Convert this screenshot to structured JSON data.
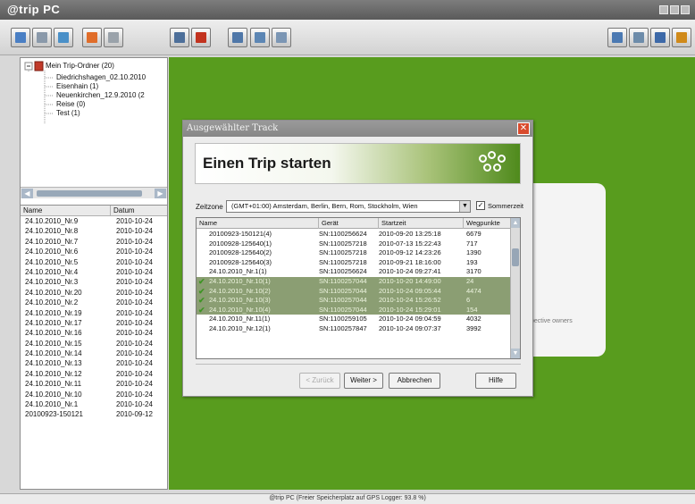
{
  "app": {
    "title": "@trip PC"
  },
  "toolbar": {
    "left_buttons": [
      {
        "name": "import-button",
        "color": "#4a7fc4"
      },
      {
        "name": "export-button",
        "color": "#8a99aa"
      },
      {
        "name": "trip-button",
        "color": "#4a90c8"
      },
      {
        "name": "settings-button",
        "color": "#e06d2a"
      },
      {
        "name": "edit-button",
        "color": "#9aa2aa"
      },
      {
        "name": "print-button",
        "color": "#4d6f9a"
      },
      {
        "name": "photo-button",
        "color": "#c2331f"
      },
      {
        "name": "slideshow-button",
        "color": "#4f77a8"
      },
      {
        "name": "map-button",
        "color": "#5c86b4"
      },
      {
        "name": "report-button",
        "color": "#7b96b4"
      }
    ],
    "right_buttons": [
      {
        "name": "device-button",
        "color": "#4b79b2"
      },
      {
        "name": "network-button",
        "color": "#6d8caa"
      },
      {
        "name": "card-button",
        "color": "#3d69a8"
      },
      {
        "name": "help-button",
        "color": "#d08a1a"
      }
    ]
  },
  "tree": {
    "root": "Mein Trip-Ordner (20)",
    "children": [
      "Diedrichshagen_02.10.2010",
      "Eisenhain (1)",
      "Neuenkirchen_12.9.2010 (2",
      "Reise (0)",
      "Test (1)"
    ]
  },
  "list": {
    "header_name": "Name",
    "header_date": "Datum",
    "rows": [
      [
        "24.10.2010_Nr.9",
        "2010-10-24"
      ],
      [
        "24.10.2010_Nr.8",
        "2010-10-24"
      ],
      [
        "24.10.2010_Nr.7",
        "2010-10-24"
      ],
      [
        "24.10.2010_Nr.6",
        "2010-10-24"
      ],
      [
        "24.10.2010_Nr.5",
        "2010-10-24"
      ],
      [
        "24.10.2010_Nr.4",
        "2010-10-24"
      ],
      [
        "24.10.2010_Nr.3",
        "2010-10-24"
      ],
      [
        "24.10.2010_Nr.20",
        "2010-10-24"
      ],
      [
        "24.10.2010_Nr.2",
        "2010-10-24"
      ],
      [
        "24.10.2010_Nr.19",
        "2010-10-24"
      ],
      [
        "24.10.2010_Nr.17",
        "2010-10-24"
      ],
      [
        "24.10.2010_Nr.16",
        "2010-10-24"
      ],
      [
        "24.10.2010_Nr.15",
        "2010-10-24"
      ],
      [
        "24.10.2010_Nr.14",
        "2010-10-24"
      ],
      [
        "24.10.2010_Nr.13",
        "2010-10-24"
      ],
      [
        "24.10.2010_Nr.12",
        "2010-10-24"
      ],
      [
        "24.10.2010_Nr.11",
        "2010-10-24"
      ],
      [
        "24.10.2010_Nr.10",
        "2010-10-24"
      ],
      [
        "24.10.2010_Nr.1",
        "2010-10-24"
      ],
      [
        "20100923-150121",
        "2010-09-12"
      ]
    ]
  },
  "background": {
    "owner_text": "pective owners"
  },
  "dialog": {
    "title": "Ausgewählter Track",
    "banner_title": "Einen Trip starten",
    "zone_label": "Zeitzone",
    "zone_value": "(GMT+01:00) Amsterdam, Berlin, Bern, Rom, Stockholm, Wien",
    "summer_label": "Sommerzeit",
    "summer_checked": true,
    "columns": [
      "Name",
      "Gerät",
      "Startzeit",
      "Wegpunkte"
    ],
    "tracks": [
      {
        "name": "20100923-150121(4)",
        "device": "SN:1100256624",
        "start": "2010-09-20 13:25:18",
        "points": "6679",
        "checked": false
      },
      {
        "name": "20100928-125640(1)",
        "device": "SN:1100257218",
        "start": "2010-07-13 15:22:43",
        "points": "717",
        "checked": false
      },
      {
        "name": "20100928-125640(2)",
        "device": "SN:1100257218",
        "start": "2010-09-12 14:23:26",
        "points": "1390",
        "checked": false
      },
      {
        "name": "20100928-125640(3)",
        "device": "SN:1100257218",
        "start": "2010-09-21 18:16:00",
        "points": "193",
        "checked": false
      },
      {
        "name": "24.10.2010_Nr.1(1)",
        "device": "SN:1100256624",
        "start": "2010-10-24 09:27:41",
        "points": "3170",
        "checked": false
      },
      {
        "name": "24.10.2010_Nr.10(1)",
        "device": "SN:1100257044",
        "start": "2010-10-20 14:49:00",
        "points": "24",
        "checked": true
      },
      {
        "name": "24.10.2010_Nr.10(2)",
        "device": "SN:1100257044",
        "start": "2010-10-24 09:05:44",
        "points": "4474",
        "checked": true
      },
      {
        "name": "24.10.2010_Nr.10(3)",
        "device": "SN:1100257044",
        "start": "2010-10-24 15:26:52",
        "points": "6",
        "checked": true
      },
      {
        "name": "24.10.2010_Nr.10(4)",
        "device": "SN:1100257044",
        "start": "2010-10-24 15:29:01",
        "points": "154",
        "checked": true
      },
      {
        "name": "24.10.2010_Nr.11(1)",
        "device": "SN:1100259105",
        "start": "2010-10-24 09:04:59",
        "points": "4032",
        "checked": false
      },
      {
        "name": "24.10.2010_Nr.12(1)",
        "device": "SN:1100257847",
        "start": "2010-10-24 09:07:37",
        "points": "3992",
        "checked": false
      }
    ],
    "back_label": "< Zurück",
    "next_label": "Weiter >",
    "cancel_label": "Abbrechen",
    "help_label": "Hilfe",
    "close_glyph": "✕"
  },
  "status": {
    "text": "@trip PC (Freier Speicherplatz auf GPS Logger: 93.8 %)"
  }
}
